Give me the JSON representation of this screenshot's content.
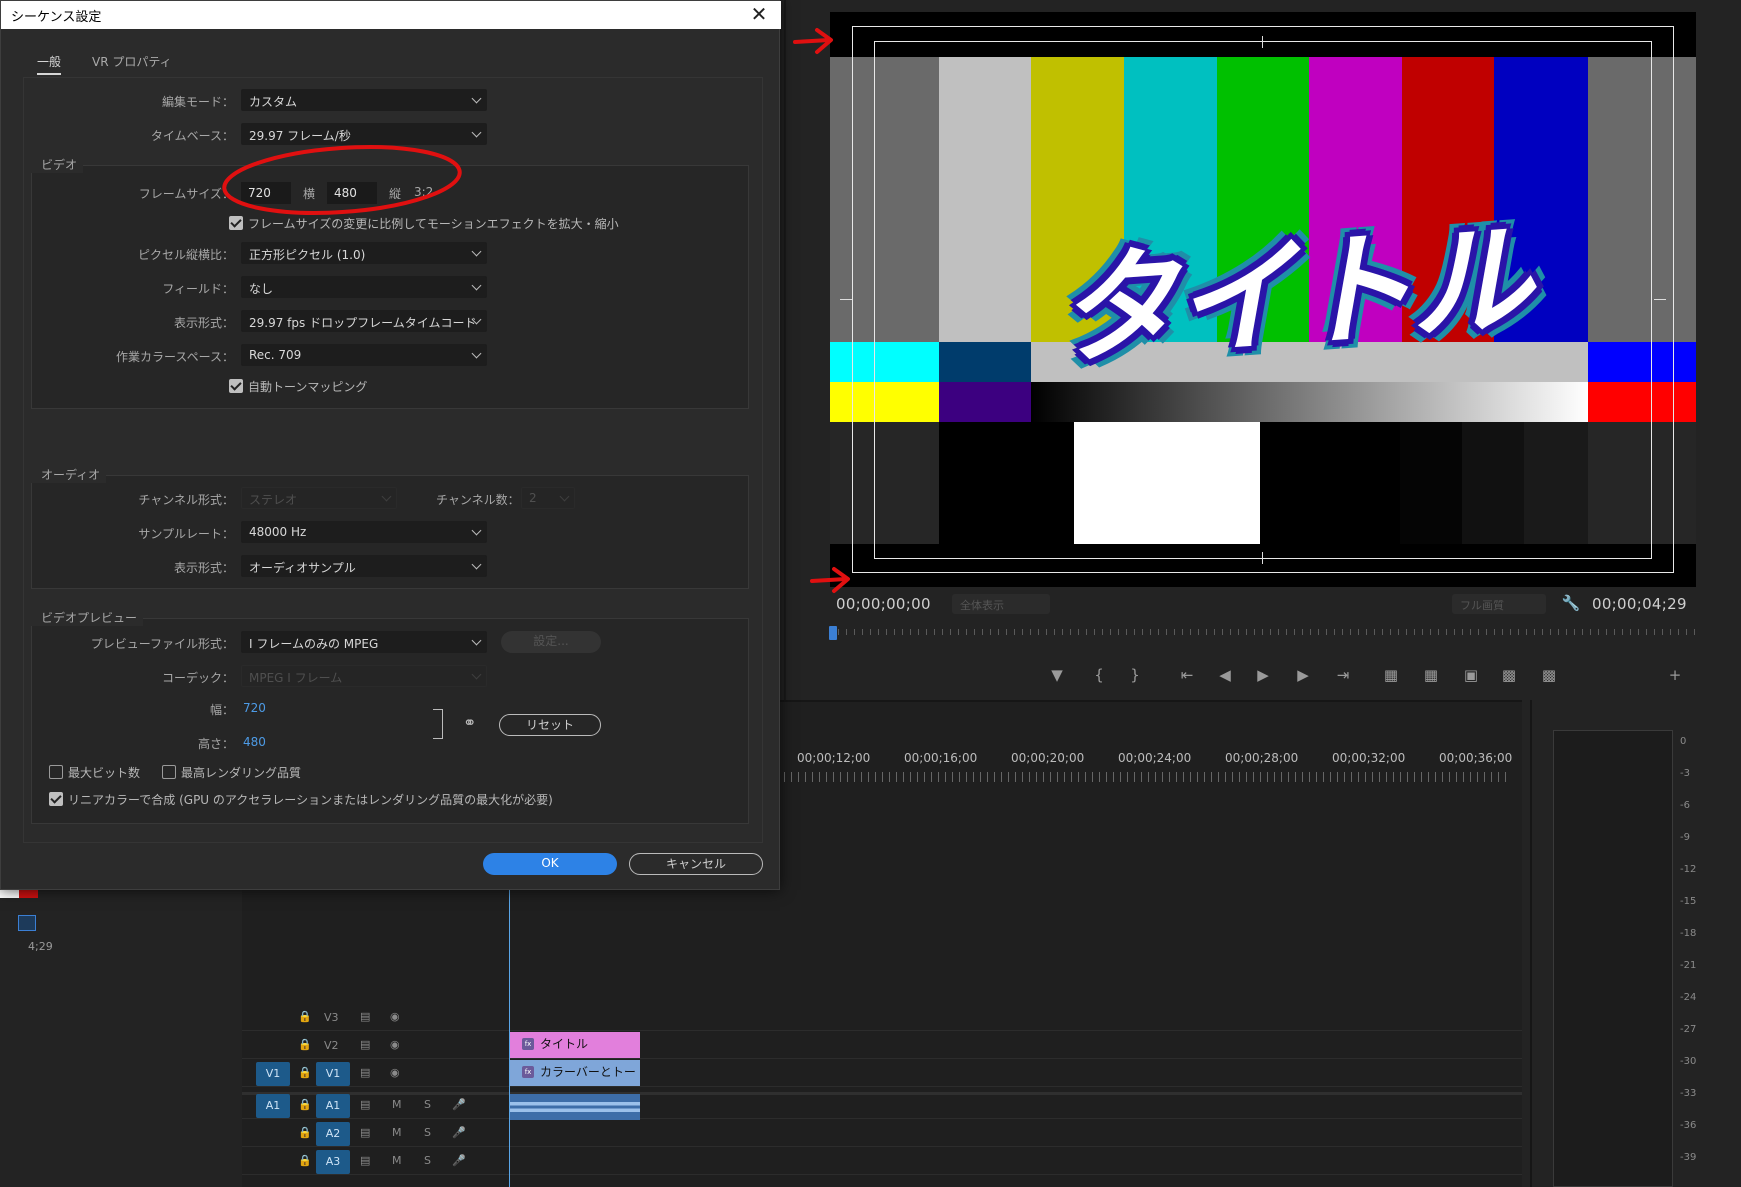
{
  "dialog": {
    "title": "シーケンス設定",
    "tabs": [
      "一般",
      "VR プロパティ"
    ],
    "general": {
      "edit_mode_label": "編集モード：",
      "edit_mode_value": "カスタム",
      "timebase_label": "タイムベース：",
      "timebase_value": "29.97  フレーム/秒"
    },
    "video": {
      "section": "ビデオ",
      "frame_size_label": "フレームサイズ：",
      "frame_width": "720",
      "width_unit": "横",
      "frame_height": "480",
      "height_unit": "縦",
      "aspect": "3:2",
      "scale_checkbox": "フレームサイズの変更に比例してモーションエフェクトを拡大・縮小",
      "pixel_aspect_label": "ピクセル縦横比：",
      "pixel_aspect_value": "正方形ピクセル (1.0)",
      "fields_label": "フィールド：",
      "fields_value": "なし",
      "display_format_label": "表示形式：",
      "display_format_value": "29.97  fps  ドロップフレームタイムコード",
      "color_space_label": "作業カラースペース：",
      "color_space_value": "Rec. 709",
      "tone_mapping": "自動トーンマッピング"
    },
    "audio": {
      "section": "オーディオ",
      "channel_format_label": "チャンネル形式：",
      "channel_format_value": "ステレオ",
      "channel_count_label": "チャンネル数：",
      "channel_count_value": "2",
      "sample_rate_label": "サンプルレート：",
      "sample_rate_value": "48000 Hz",
      "display_format_label": "表示形式：",
      "display_format_value": "オーディオサンプル"
    },
    "video_preview": {
      "section": "ビデオプレビュー",
      "file_format_label": "プレビューファイル形式：",
      "file_format_value": "I フレームのみの MPEG",
      "settings_button": "設定...",
      "codec_label": "コーデック：",
      "codec_value": "MPEG I フレーム",
      "width_label": "幅：",
      "width_value": "720",
      "height_label": "高さ：",
      "height_value": "480",
      "reset_button": "リセット",
      "max_bit_depth": "最大ビット数",
      "max_render_quality": "最高レンダリング品質",
      "linear_color": "リニアカラーで合成 (GPU のアクセラレーションまたはレンダリング品質の最大化が必要)"
    },
    "ok_button": "OK",
    "cancel_button": "キャンセル"
  },
  "monitor": {
    "title_overlay": "タイトル",
    "timecode_start": "00;00;00;00",
    "fit_dropdown": "全体表示",
    "quality_dropdown": "フル画質",
    "timecode_end": "00;00;04;29"
  },
  "timeline": {
    "ruler": [
      "00;00;12;00",
      "00;00;16;00",
      "00;00;20;00",
      "00;00;24;00",
      "00;00;28;00",
      "00;00;32;00",
      "00;00;36;00"
    ],
    "tracks": [
      "V3",
      "V2",
      "V1",
      "A1",
      "A2",
      "A3"
    ],
    "source_v": "V1",
    "source_a": "A1",
    "clip_title": "タイトル",
    "clip_bars": "カラーバーとトー",
    "left_timecode": "4;29"
  },
  "meter": {
    "labels": [
      "0",
      "-3",
      "-6",
      "-9",
      "-12",
      "-15",
      "-18",
      "-21",
      "-24",
      "-27",
      "-30",
      "-33",
      "-36",
      "-39"
    ]
  },
  "colors": {
    "accent_blue": "#2d82e6",
    "annotation_red": "#e01010",
    "track_tag_blue": "#1d5a8a",
    "clip_title_pink": "#e27fdc",
    "clip_bars_blue": "#7fa6d9"
  }
}
